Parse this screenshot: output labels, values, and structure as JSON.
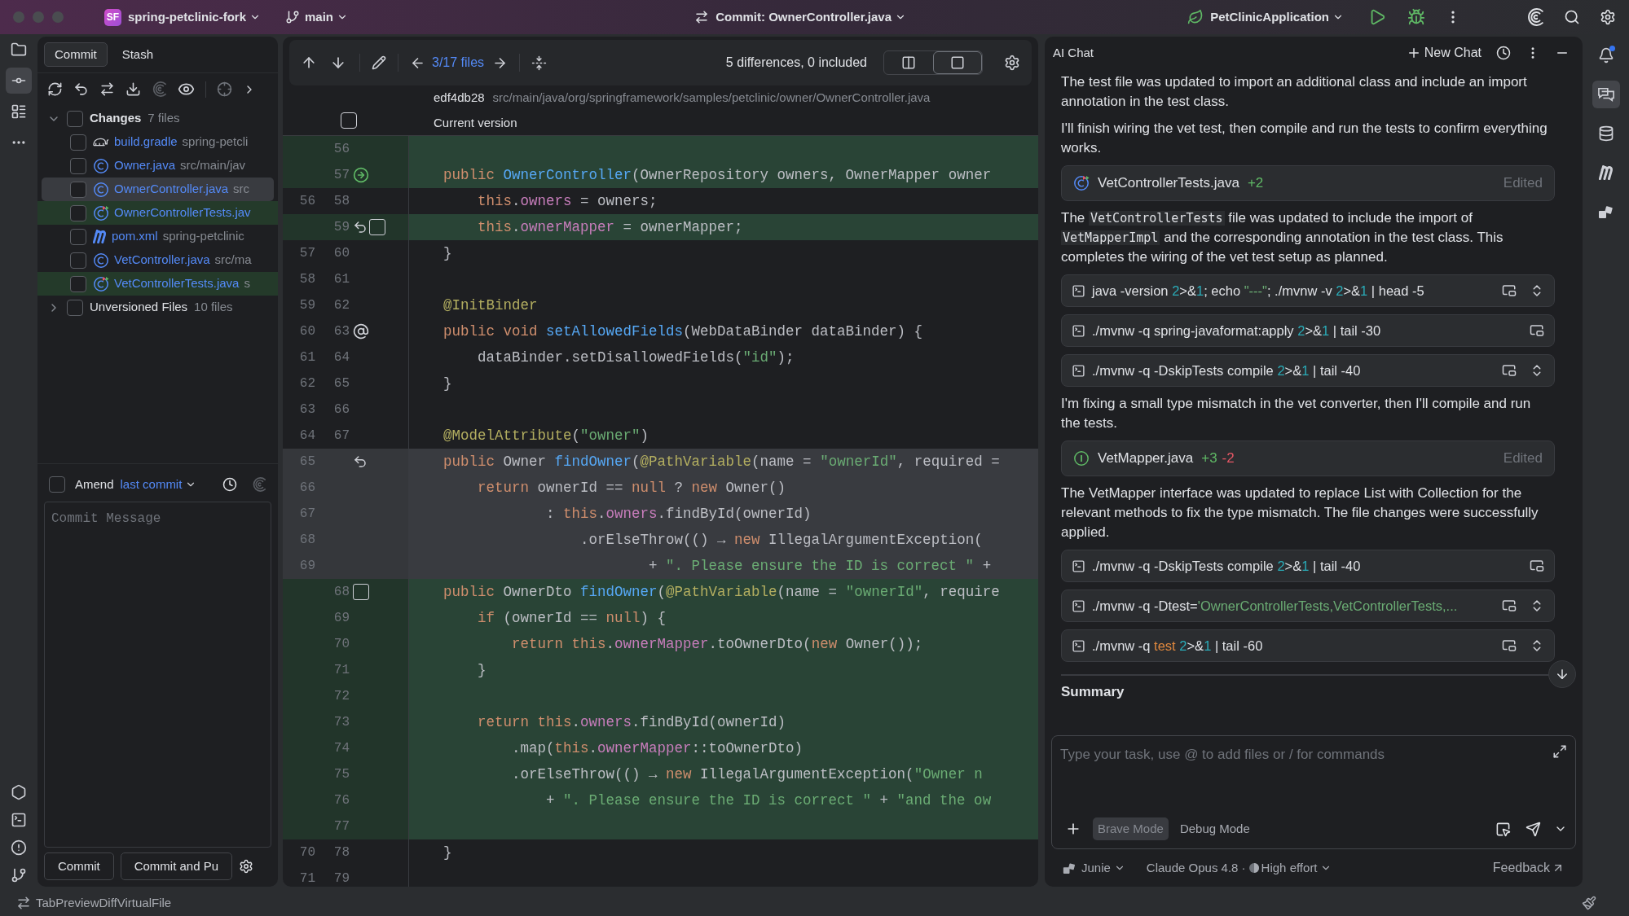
{
  "title_bar": {
    "project_badge": "SF",
    "project": "spring-petclinic-fork",
    "branch": "main",
    "file_title": "Commit: OwnerController.java",
    "run_config": "PetClinicApplication"
  },
  "left_toolbar": [
    {
      "kind": "folder",
      "selected": false
    },
    {
      "kind": "commit",
      "selected": true
    },
    {
      "kind": "structure",
      "selected": false
    },
    {
      "kind": "more",
      "selected": false
    }
  ],
  "left_toolbar_bottom": [
    {
      "kind": "services"
    },
    {
      "kind": "terminal"
    },
    {
      "kind": "problems"
    },
    {
      "kind": "git"
    }
  ],
  "commit_panel": {
    "tabs": [
      {
        "label": "Commit",
        "selected": true
      },
      {
        "label": "Stash",
        "selected": false
      }
    ],
    "changes": {
      "label": "Changes",
      "count": "7 files",
      "expanded": true,
      "checked": false,
      "files": [
        {
          "name": "build.gradle",
          "path": "spring-petcli",
          "kind": "gradle",
          "selected": false,
          "highlighted": false
        },
        {
          "name": "Owner.java",
          "path": "src/main/jav",
          "kind": "class",
          "selected": false,
          "highlighted": false
        },
        {
          "name": "OwnerController.java",
          "path": "src",
          "kind": "class",
          "selected": true,
          "highlighted": false
        },
        {
          "name": "OwnerControllerTests.jav",
          "kind": "test",
          "selected": false,
          "highlighted": true
        },
        {
          "name": "pom.xml",
          "path": "spring-petclinic",
          "kind": "maven",
          "selected": false,
          "highlighted": false
        },
        {
          "name": "VetController.java",
          "path": "src/ma",
          "kind": "class",
          "selected": false,
          "highlighted": false
        },
        {
          "name": "VetControllerTests.java",
          "path": "s",
          "kind": "test",
          "selected": false,
          "highlighted": true
        }
      ]
    },
    "unversioned": {
      "label": "Unversioned Files",
      "count": "10 files",
      "expanded": false,
      "checked": false
    },
    "amend": {
      "label": "Amend",
      "link": "last commit",
      "checked": false
    },
    "message": {
      "placeholder": "Commit Message"
    },
    "buttons": [
      "Commit",
      "Commit and Pu"
    ]
  },
  "diff": {
    "nav": "3/17 files",
    "summary": "5 differences, 0 included",
    "view_modes": [
      {
        "kind": "split",
        "selected": false
      },
      {
        "kind": "unified",
        "selected": true
      }
    ],
    "revision": "edf4db28",
    "path": "src/main/java/org/springframework/samples/petclinic/owner/OwnerController.java",
    "version_label": "Current version",
    "version_checked": false,
    "lines": [
      {
        "new": "56",
        "kind": "added"
      },
      {
        "new": "57",
        "kind": "added",
        "gutter": [
          {
            "kind": "apply"
          }
        ],
        "code": [
          {
            "text": "    public ",
            "kind": "kw"
          },
          {
            "text": "OwnerController",
            "kind": "fn"
          },
          {
            "text": "(OwnerRepository owners, OwnerMapper owner",
            "kind": "plain"
          }
        ]
      },
      {
        "old": "56",
        "new": "58",
        "kind": "unchanged",
        "code": [
          {
            "text": "        this",
            "kind": "kw"
          },
          {
            "text": ".",
            "kind": "plain"
          },
          {
            "text": "owners",
            "kind": "field"
          },
          {
            "text": " = owners;",
            "kind": "plain"
          }
        ]
      },
      {
        "new": "59",
        "kind": "added",
        "gutter": [
          {
            "kind": "revert"
          },
          {
            "kind": "checkbox"
          }
        ],
        "code": [
          {
            "text": "        this",
            "kind": "kw"
          },
          {
            "text": ".",
            "kind": "plain"
          },
          {
            "text": "ownerMapper",
            "kind": "field"
          },
          {
            "text": " = ownerMapper;",
            "kind": "plain"
          }
        ]
      },
      {
        "old": "57",
        "new": "60",
        "kind": "unchanged",
        "code": [
          {
            "text": "    }",
            "kind": "plain"
          }
        ]
      },
      {
        "old": "58",
        "new": "61",
        "kind": "unchanged"
      },
      {
        "old": "59",
        "new": "62",
        "kind": "unchanged",
        "code": [
          {
            "text": "    @InitBinder",
            "kind": "ann"
          }
        ]
      },
      {
        "old": "60",
        "new": "63",
        "kind": "unchanged",
        "gutter": [
          {
            "kind": "mention"
          }
        ],
        "code": [
          {
            "text": "    public void ",
            "kind": "kw"
          },
          {
            "text": "setAllowedFields",
            "kind": "fn"
          },
          {
            "text": "(WebDataBinder dataBinder) {",
            "kind": "plain"
          }
        ]
      },
      {
        "old": "61",
        "new": "64",
        "kind": "unchanged",
        "code": [
          {
            "text": "        dataBinder.setDisallowedFields(",
            "kind": "plain"
          },
          {
            "text": "\"id\"",
            "kind": "str"
          },
          {
            "text": ");",
            "kind": "plain"
          }
        ]
      },
      {
        "old": "62",
        "new": "65",
        "kind": "unchanged",
        "code": [
          {
            "text": "    }",
            "kind": "plain"
          }
        ]
      },
      {
        "old": "63",
        "new": "66",
        "kind": "unchanged"
      },
      {
        "old": "64",
        "new": "67",
        "kind": "unchanged",
        "code": [
          {
            "text": "    @ModelAttribute",
            "kind": "ann"
          },
          {
            "text": "(",
            "kind": "plain"
          },
          {
            "text": "\"owner\"",
            "kind": "str"
          },
          {
            "text": ")",
            "kind": "plain"
          }
        ]
      },
      {
        "old": "65",
        "kind": "removed",
        "gutter": [
          {
            "kind": "revert"
          }
        ],
        "code": [
          {
            "text": "    public ",
            "kind": "kw"
          },
          {
            "text": "Owner ",
            "kind": "plain"
          },
          {
            "text": "findOwner",
            "kind": "fn"
          },
          {
            "text": "(",
            "kind": "plain"
          },
          {
            "text": "@PathVariable",
            "kind": "ann"
          },
          {
            "text": "(name = ",
            "kind": "plain"
          },
          {
            "text": "\"ownerId\"",
            "kind": "str"
          },
          {
            "text": ", required =",
            "kind": "plain"
          }
        ]
      },
      {
        "old": "66",
        "kind": "removed",
        "code": [
          {
            "text": "        return ",
            "kind": "kw"
          },
          {
            "text": "ownerId == ",
            "kind": "plain"
          },
          {
            "text": "null",
            "kind": "kw"
          },
          {
            "text": " ? ",
            "kind": "plain"
          },
          {
            "text": "new ",
            "kind": "kw"
          },
          {
            "text": "Owner()",
            "kind": "plain"
          }
        ]
      },
      {
        "old": "67",
        "kind": "removed",
        "code": [
          {
            "text": "                : ",
            "kind": "plain"
          },
          {
            "text": "this",
            "kind": "kw"
          },
          {
            "text": ".",
            "kind": "plain"
          },
          {
            "text": "owners",
            "kind": "field"
          },
          {
            "text": ".findById(ownerId)",
            "kind": "plain"
          }
        ]
      },
      {
        "old": "68",
        "kind": "removed",
        "code": [
          {
            "text": "                    .orElseThrow(() → ",
            "kind": "plain"
          },
          {
            "text": "new ",
            "kind": "kw"
          },
          {
            "text": "IllegalArgumentException(",
            "kind": "plain"
          }
        ]
      },
      {
        "old": "69",
        "kind": "removed",
        "code": [
          {
            "text": "                            + ",
            "kind": "plain"
          },
          {
            "text": "\". Please ensure the ID is correct \"",
            "kind": "str"
          },
          {
            "text": " +",
            "kind": "plain"
          }
        ]
      },
      {
        "new": "68",
        "kind": "added",
        "gutter": [
          {
            "kind": "checkbox"
          }
        ],
        "code": [
          {
            "text": "    public ",
            "kind": "kw"
          },
          {
            "text": "OwnerDto ",
            "kind": "plain"
          },
          {
            "text": "findOwner",
            "kind": "fn"
          },
          {
            "text": "(",
            "kind": "plain"
          },
          {
            "text": "@PathVariable",
            "kind": "ann"
          },
          {
            "text": "(name = ",
            "kind": "plain"
          },
          {
            "text": "\"ownerId\"",
            "kind": "str"
          },
          {
            "text": ", require",
            "kind": "plain"
          }
        ]
      },
      {
        "new": "69",
        "kind": "added",
        "code": [
          {
            "text": "        if ",
            "kind": "kw"
          },
          {
            "text": "(ownerId == ",
            "kind": "plain"
          },
          {
            "text": "null",
            "kind": "kw"
          },
          {
            "text": ") {",
            "kind": "plain"
          }
        ]
      },
      {
        "new": "70",
        "kind": "added",
        "code": [
          {
            "text": "            return this",
            "kind": "kw"
          },
          {
            "text": ".",
            "kind": "plain"
          },
          {
            "text": "ownerMapper",
            "kind": "field"
          },
          {
            "text": ".toOwnerDto(",
            "kind": "plain"
          },
          {
            "text": "new ",
            "kind": "kw"
          },
          {
            "text": "Owner());",
            "kind": "plain"
          }
        ]
      },
      {
        "new": "71",
        "kind": "added",
        "code": [
          {
            "text": "        }",
            "kind": "plain"
          }
        ]
      },
      {
        "new": "72",
        "kind": "added"
      },
      {
        "new": "73",
        "kind": "added",
        "code": [
          {
            "text": "        return this",
            "kind": "kw"
          },
          {
            "text": ".",
            "kind": "plain"
          },
          {
            "text": "owners",
            "kind": "field"
          },
          {
            "text": ".findById(ownerId)",
            "kind": "plain"
          }
        ]
      },
      {
        "new": "74",
        "kind": "added",
        "code": [
          {
            "text": "            .map(",
            "kind": "plain"
          },
          {
            "text": "this",
            "kind": "kw"
          },
          {
            "text": ".",
            "kind": "plain"
          },
          {
            "text": "ownerMapper",
            "kind": "field"
          },
          {
            "text": "::toOwnerDto)",
            "kind": "plain"
          }
        ]
      },
      {
        "new": "75",
        "kind": "added",
        "code": [
          {
            "text": "            .orElseThrow(() → ",
            "kind": "plain"
          },
          {
            "text": "new ",
            "kind": "kw"
          },
          {
            "text": "IllegalArgumentException(",
            "kind": "plain"
          },
          {
            "text": "\"Owner n",
            "kind": "str"
          }
        ]
      },
      {
        "new": "76",
        "kind": "added",
        "code": [
          {
            "text": "                + ",
            "kind": "plain"
          },
          {
            "text": "\". Please ensure the ID is correct \"",
            "kind": "str"
          },
          {
            "text": " + ",
            "kind": "plain"
          },
          {
            "text": "\"and the ow",
            "kind": "str"
          }
        ]
      },
      {
        "new": "77",
        "kind": "added"
      },
      {
        "old": "70",
        "new": "78",
        "kind": "unchanged",
        "code": [
          {
            "text": "    }",
            "kind": "plain"
          }
        ]
      },
      {
        "old": "71",
        "new": "79",
        "kind": "unchanged"
      }
    ]
  },
  "chat": {
    "title": "AI Chat",
    "new_chat": "New Chat",
    "messages": [
      {
        "kind": "text",
        "parts": [
          {
            "text": "The test file was updated to import an additional class and include an import annotation in the test class.",
            "kind": "text"
          }
        ]
      },
      {
        "kind": "text",
        "parts": [
          {
            "text": "I'll finish wiring the vet test, then compile and run the tests to confirm everything works.",
            "kind": "text"
          }
        ]
      },
      {
        "kind": "testfile",
        "name": "VetControllerTests.java",
        "added": "+2",
        "status": "Edited"
      },
      {
        "kind": "text",
        "parts": [
          {
            "text": "The ",
            "kind": "text"
          },
          {
            "text": "VetControllerTests",
            "kind": "code"
          },
          {
            "text": " file was updated to include the import of ",
            "kind": "text"
          },
          {
            "text": "VetMapperImpl",
            "kind": "code"
          },
          {
            "text": " and the corresponding annotation in the test class. This completes the wiring of the vet test setup as planned.",
            "kind": "text"
          }
        ]
      },
      {
        "kind": "command",
        "expandable": true,
        "parts": [
          {
            "text": "java -version ",
            "kind": "plain"
          },
          {
            "text": "2",
            "kind": "num"
          },
          {
            "text": ">&",
            "kind": "plain"
          },
          {
            "text": "1",
            "kind": "num"
          },
          {
            "text": "; echo ",
            "kind": "plain"
          },
          {
            "text": "\"---\"",
            "kind": "str"
          },
          {
            "text": "; ./mvnw -v ",
            "kind": "plain"
          },
          {
            "text": "2",
            "kind": "num"
          },
          {
            "text": ">&",
            "kind": "plain"
          },
          {
            "text": "1",
            "kind": "num"
          },
          {
            "text": " | head -5",
            "kind": "plain"
          }
        ]
      },
      {
        "kind": "command",
        "expandable": false,
        "parts": [
          {
            "text": "./mvnw -q spring-javaformat:apply ",
            "kind": "plain"
          },
          {
            "text": "2",
            "kind": "num"
          },
          {
            "text": ">&",
            "kind": "plain"
          },
          {
            "text": "1",
            "kind": "num"
          },
          {
            "text": " | tail -30",
            "kind": "plain"
          }
        ]
      },
      {
        "kind": "command",
        "expandable": true,
        "parts": [
          {
            "text": "./mvnw -q -DskipTests compile ",
            "kind": "plain"
          },
          {
            "text": "2",
            "kind": "num"
          },
          {
            "text": ">&",
            "kind": "plain"
          },
          {
            "text": "1",
            "kind": "num"
          },
          {
            "text": " | tail -40",
            "kind": "plain"
          }
        ]
      },
      {
        "kind": "text",
        "parts": [
          {
            "text": "I'm fixing a small type mismatch in the vet converter, then I'll compile and run the tests.",
            "kind": "text"
          }
        ]
      },
      {
        "kind": "interfacefile",
        "name": "VetMapper.java",
        "added": "+3",
        "removed": "-2",
        "status": "Edited"
      },
      {
        "kind": "text",
        "parts": [
          {
            "text": "The VetMapper interface was updated to replace List with Collection for the relevant methods to fix the type mismatch. The file changes were successfully applied.",
            "kind": "text"
          }
        ]
      },
      {
        "kind": "command",
        "expandable": false,
        "parts": [
          {
            "text": "./mvnw -q -DskipTests compile ",
            "kind": "plain"
          },
          {
            "text": "2",
            "kind": "num"
          },
          {
            "text": ">&",
            "kind": "plain"
          },
          {
            "text": "1",
            "kind": "num"
          },
          {
            "text": " | tail -40",
            "kind": "plain"
          }
        ]
      },
      {
        "kind": "command",
        "expandable": true,
        "parts": [
          {
            "text": "./mvnw -q -Dtest=",
            "kind": "plain"
          },
          {
            "text": "'OwnerControllerTests,VetControllerTests,...",
            "kind": "str"
          }
        ]
      },
      {
        "kind": "command",
        "expandable": true,
        "parts": [
          {
            "text": "./mvnw -q ",
            "kind": "plain"
          },
          {
            "text": "test ",
            "kind": "kw"
          },
          {
            "text": "2",
            "kind": "num"
          },
          {
            "text": ">&",
            "kind": "plain"
          },
          {
            "text": "1",
            "kind": "num"
          },
          {
            "text": " | tail -60",
            "kind": "plain"
          }
        ]
      },
      {
        "kind": "heading",
        "text": "Summary"
      }
    ],
    "input": {
      "placeholder": "Type your task, use @ to add files or / for commands",
      "modes": [
        {
          "label": "Brave Mode",
          "selected": true
        },
        {
          "label": "Debug Mode",
          "selected": false
        }
      ]
    },
    "footer": {
      "agent": "Junie",
      "model": "Claude Opus 4.8 ·",
      "effort": "High effort",
      "feedback": "Feedback"
    }
  },
  "right_toolbar": [
    {
      "kind": "bell",
      "selected": false,
      "unread": true
    },
    {
      "kind": "chat",
      "selected": true,
      "unread": false
    },
    {
      "kind": "database",
      "selected": false,
      "unread": false
    },
    {
      "kind": "maven",
      "selected": false,
      "unread": false
    },
    {
      "kind": "shapes",
      "selected": false,
      "unread": false
    }
  ],
  "status_bar": {
    "text": "TabPreviewDiffVirtualFile"
  }
}
